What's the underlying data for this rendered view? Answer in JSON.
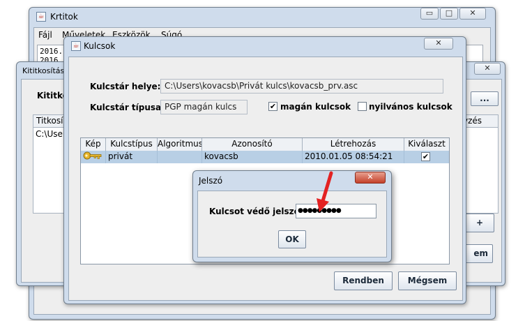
{
  "krtitok": {
    "title": "Krtitok",
    "menu": [
      "Fájl",
      "Műveletek",
      "Eszközök",
      "Súgó"
    ],
    "log_lines": [
      "2016.",
      "2016."
    ]
  },
  "kititkositas": {
    "title": "Kititkosítás",
    "panel_title": "Kititko",
    "col_titkosi": "Titkosí",
    "cell_path": "C:\\Users",
    "col_right": "yzés",
    "browse_label": "...",
    "plus_label": "+",
    "partial_button": "em"
  },
  "kulcsok": {
    "title": "Kulcsok",
    "keystore_location_label": "Kulcstár helye:",
    "keystore_location_value": "C:\\Users\\kovacsb\\Privát kulcs\\kovacsb_prv.asc",
    "keystore_type_label": "Kulcstár típusa:",
    "keystore_type_value": "PGP magán kulcs",
    "private_keys_label": "magán kulcsok",
    "private_keys_checked": true,
    "public_keys_label": "nyilvános kulcsok",
    "public_keys_checked": false,
    "table": {
      "headers": [
        "Kép",
        "Kulcstípus",
        "Algoritmus",
        "Azonosító",
        "Létrehozás",
        "Kiválaszt"
      ],
      "rows": [
        {
          "icon": "key-icon",
          "type": "privát",
          "algorithm": "",
          "id": "kovacsb",
          "created": "2010.01.05 08:54:21",
          "selected": true
        }
      ]
    },
    "ok_button": "Rendben",
    "cancel_button": "Mégsem"
  },
  "jelszo": {
    "title": "Jelszó",
    "password_label": "Kulcsot védő jelszó:",
    "password_masked": "●●●●●●●●●",
    "ok_button": "OK"
  },
  "colors": {
    "frame": "#cfdcec",
    "content_bg": "#eeeeee",
    "selected_row": "#b8cfe5",
    "annotation_arrow": "#e32222"
  }
}
